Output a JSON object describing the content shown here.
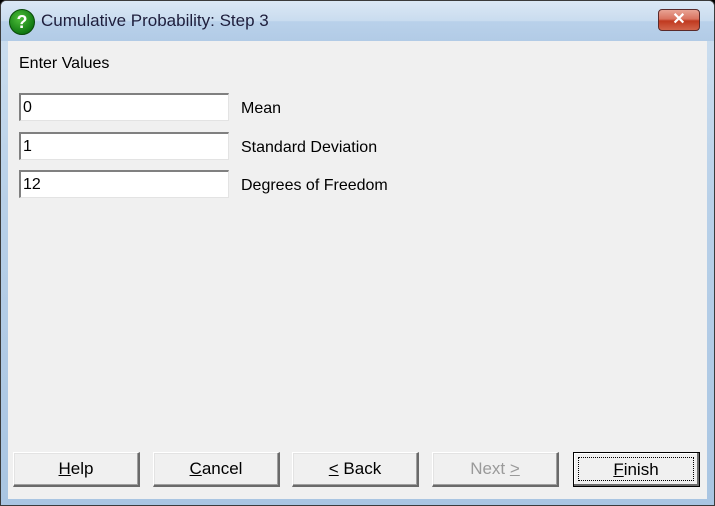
{
  "window": {
    "title": "Cumulative Probability: Step 3",
    "icon": "help-question-icon",
    "close_glyph": "✕"
  },
  "form": {
    "heading": "Enter Values",
    "fields": [
      {
        "label": "Mean",
        "value": "0"
      },
      {
        "label": "Standard Deviation",
        "value": "1"
      },
      {
        "label": "Degrees of Freedom",
        "value": "12"
      }
    ]
  },
  "buttons": {
    "help": {
      "mnemonic": "H",
      "rest": "elp"
    },
    "cancel": {
      "mnemonic": "C",
      "rest": "ancel"
    },
    "back": {
      "mnemonic": "<",
      "rest": " Back"
    },
    "next": {
      "pre": "Next ",
      "mnemonic": ">"
    },
    "finish": {
      "mnemonic": "F",
      "rest": "inish"
    }
  }
}
